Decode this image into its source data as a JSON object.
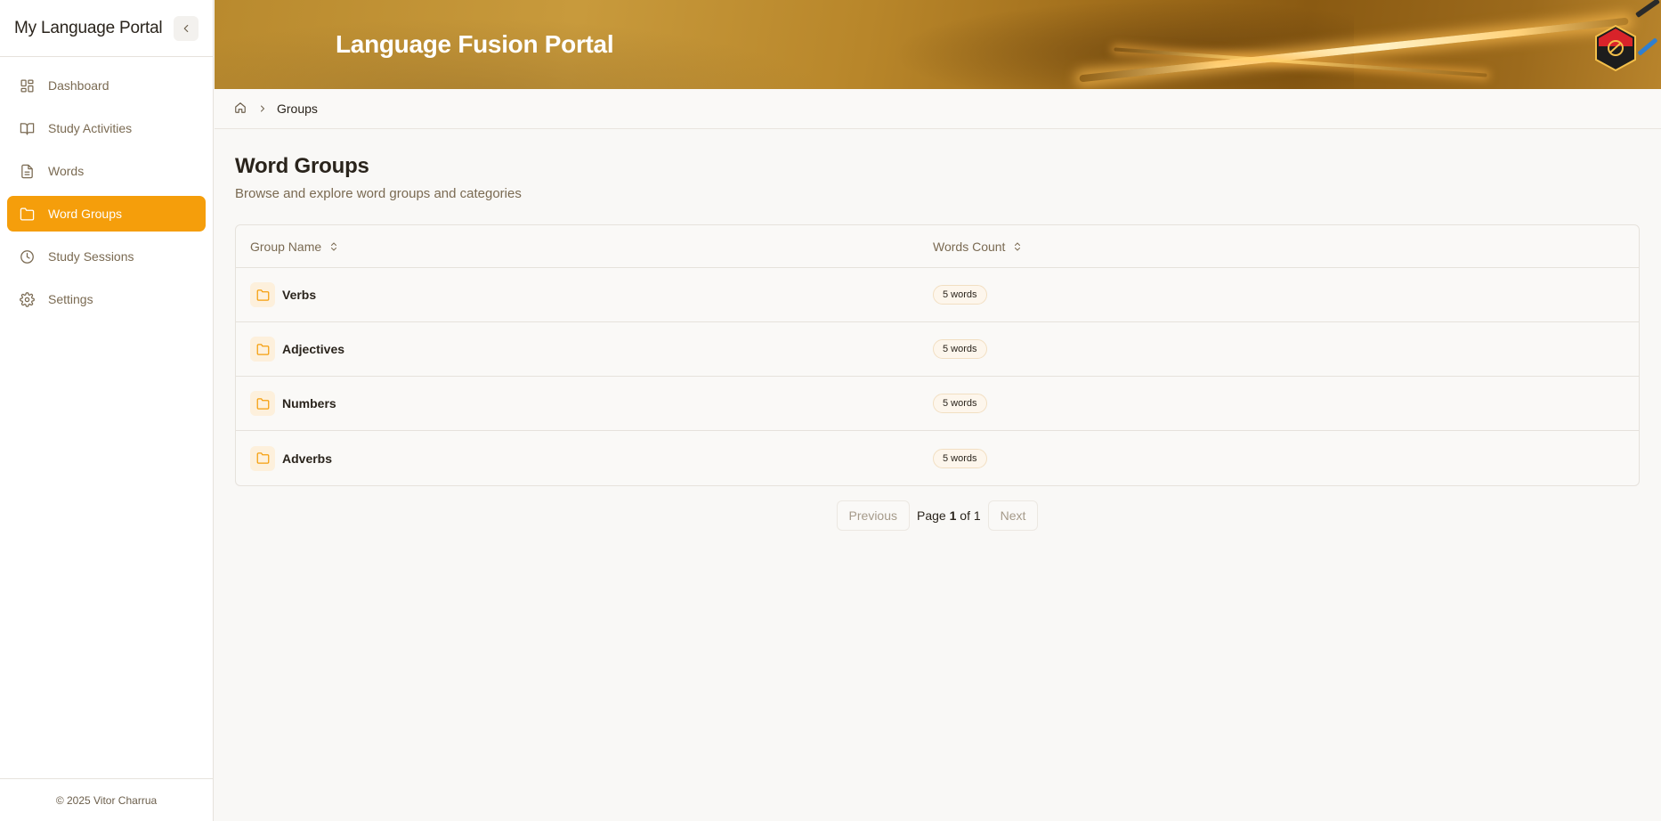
{
  "app": {
    "brand": "My Language Portal",
    "footer": "© 2025 Vitor Charrua"
  },
  "sidebar": {
    "items": [
      {
        "label": "Dashboard",
        "icon": "grid-icon",
        "active": false
      },
      {
        "label": "Study Activities",
        "icon": "book-icon",
        "active": false
      },
      {
        "label": "Words",
        "icon": "document-icon",
        "active": false
      },
      {
        "label": "Word Groups",
        "icon": "folder-icon",
        "active": true
      },
      {
        "label": "Study Sessions",
        "icon": "clock-icon",
        "active": false
      },
      {
        "label": "Settings",
        "icon": "gear-icon",
        "active": false
      }
    ]
  },
  "banner": {
    "title": "Language Fusion Portal"
  },
  "breadcrumb": {
    "current": "Groups"
  },
  "page": {
    "title": "Word Groups",
    "subtitle": "Browse and explore word groups and categories"
  },
  "table": {
    "columns": [
      "Group Name",
      "Words Count"
    ],
    "rows": [
      {
        "name": "Verbs",
        "count": "5 words"
      },
      {
        "name": "Adjectives",
        "count": "5 words"
      },
      {
        "name": "Numbers",
        "count": "5 words"
      },
      {
        "name": "Adverbs",
        "count": "5 words"
      }
    ]
  },
  "pagination": {
    "previous": "Previous",
    "next": "Next",
    "page_label": "Page",
    "current": "1",
    "of_label": "of",
    "total": "1"
  },
  "colors": {
    "accent": "#f59e0b",
    "text": "#2a241c",
    "muted": "#7a6a52"
  }
}
